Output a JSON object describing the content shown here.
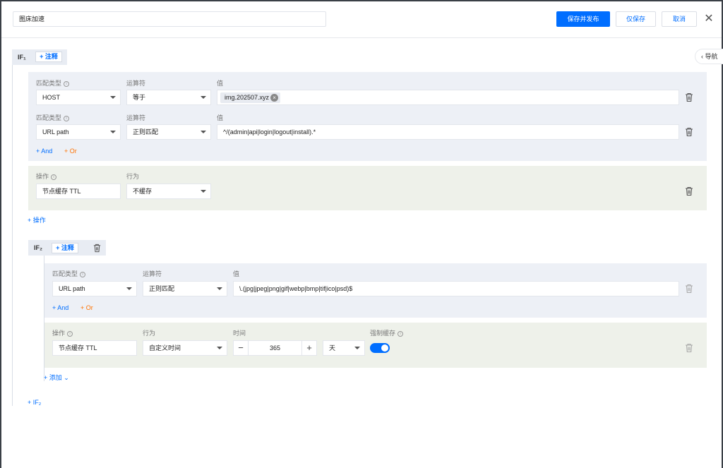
{
  "header": {
    "title_value": "图床加速",
    "save_publish_label": "保存并发布",
    "save_only_label": "仅保存",
    "cancel_label": "取消",
    "close_icon": "close-icon"
  },
  "nav": {
    "label": "导航",
    "icon": "chevron-left-icon"
  },
  "rules": [
    {
      "label": "IF₁",
      "note_label": "+ 注释",
      "conditions": [
        {
          "match_type_label": "匹配类型",
          "operator_label": "运算符",
          "value_label": "值",
          "match_type": "HOST",
          "operator": "等于",
          "value_tag": "img.202507.xyz"
        },
        {
          "match_type_label": "匹配类型",
          "operator_label": "运算符",
          "value_label": "值",
          "match_type": "URL path",
          "operator": "正则匹配",
          "value": "^/(admin|api|login|logout|install).*"
        }
      ],
      "and_label": "+ And",
      "or_label": "+ Or",
      "action": {
        "action_label": "操作",
        "behavior_label": "行为",
        "action": "节点缓存 TTL",
        "behavior": "不缓存"
      },
      "add_action_label": "+ 操作"
    },
    {
      "label": "IF₂",
      "note_label": "+ 注释",
      "conditions": [
        {
          "match_type_label": "匹配类型",
          "operator_label": "运算符",
          "value_label": "值",
          "match_type": "URL path",
          "operator": "正则匹配",
          "value": "\\.(jpg|jpeg|png|gif|webp|bmp|tif|ico|psd)$"
        }
      ],
      "and_label": "+ And",
      "or_label": "+ Or",
      "action": {
        "action_label": "操作",
        "behavior_label": "行为",
        "time_label": "时间",
        "force_cache_label": "强制缓存",
        "action": "节点缓存 TTL",
        "behavior": "自定义时间",
        "time_value": "365",
        "time_unit": "天",
        "force_cache_on": true
      },
      "add_label": "+ 添加"
    }
  ],
  "add_if_label": "+ IF₂",
  "colors": {
    "accent": "#006eff",
    "or": "#ff7200",
    "cond_panel": "#edf0f6",
    "action_panel": "#eef1ea"
  }
}
